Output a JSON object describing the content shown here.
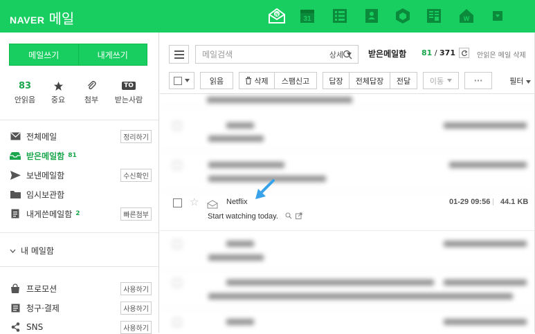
{
  "brand": {
    "naver": "NAVER",
    "mail": "메일"
  },
  "top_apps": [
    {
      "name": "mail-app-icon"
    },
    {
      "name": "calendar-app-icon",
      "label": "31"
    },
    {
      "name": "contacts-list-app-icon"
    },
    {
      "name": "address-book-app-icon"
    },
    {
      "name": "cube-app-icon"
    },
    {
      "name": "memo-app-icon"
    },
    {
      "name": "home-app-icon"
    },
    {
      "name": "more-app-icon"
    }
  ],
  "sidebar": {
    "write_mail": "메일쓰기",
    "write_self": "내게쓰기",
    "quick": {
      "unread_count": "83",
      "unread_label": "안읽음",
      "important_label": "중요",
      "attach_label": "첨부",
      "to_badge": "TO",
      "to_me_label": "받는사람"
    },
    "all_mail": {
      "label": "전체메일",
      "action": "정리하기"
    },
    "inbox": {
      "label": "받은메일함",
      "count": "81"
    },
    "sent": {
      "label": "보낸메일함",
      "action": "수신확인"
    },
    "drafts": {
      "label": "임시보관함"
    },
    "self_box": {
      "label": "내게쓴메일함",
      "count": "2",
      "action": "빠른첨부"
    },
    "my_mail": "내 메일함",
    "promo": {
      "label": "프로모션",
      "action": "사용하기"
    },
    "billing": {
      "label": "청구·결제",
      "action": "사용하기"
    },
    "sns": {
      "label": "SNS",
      "action": "사용하기"
    }
  },
  "main": {
    "search_placeholder": "메일검색",
    "detail": "상세",
    "box_name": "받은메일함",
    "unread": "81",
    "sep": "/",
    "total": "371",
    "unread_delete": "안읽은 메일 삭제",
    "toolbar": {
      "read": "읽음",
      "delete": "삭제",
      "spam": "스팸신고",
      "reply": "답장",
      "reply_all": "전체답장",
      "forward": "전달",
      "move": "이동",
      "more": "···",
      "filter": "필터"
    },
    "netflix": {
      "sender": "Netflix",
      "subject": "Start watching today.",
      "date": "01-29 09:56",
      "size": "44.1 KB"
    }
  },
  "colors": {
    "brand_green": "#19ce60",
    "count_green": "#19a64c",
    "arrow_blue": "#3aa2e8"
  }
}
